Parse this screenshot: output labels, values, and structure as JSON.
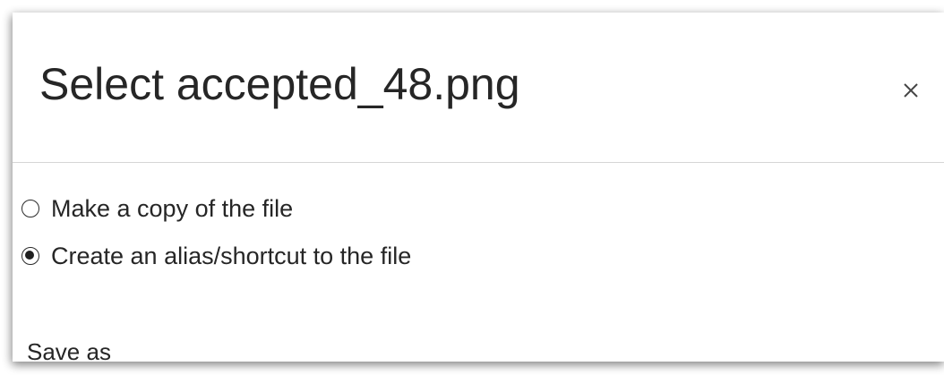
{
  "dialog": {
    "title": "Select accepted_48.png",
    "close_icon": "close-icon"
  },
  "options": [
    {
      "label": "Make a copy of the file",
      "selected": false
    },
    {
      "label": "Create an alias/shortcut to the file",
      "selected": true
    }
  ],
  "save_as": {
    "label": "Save as"
  }
}
